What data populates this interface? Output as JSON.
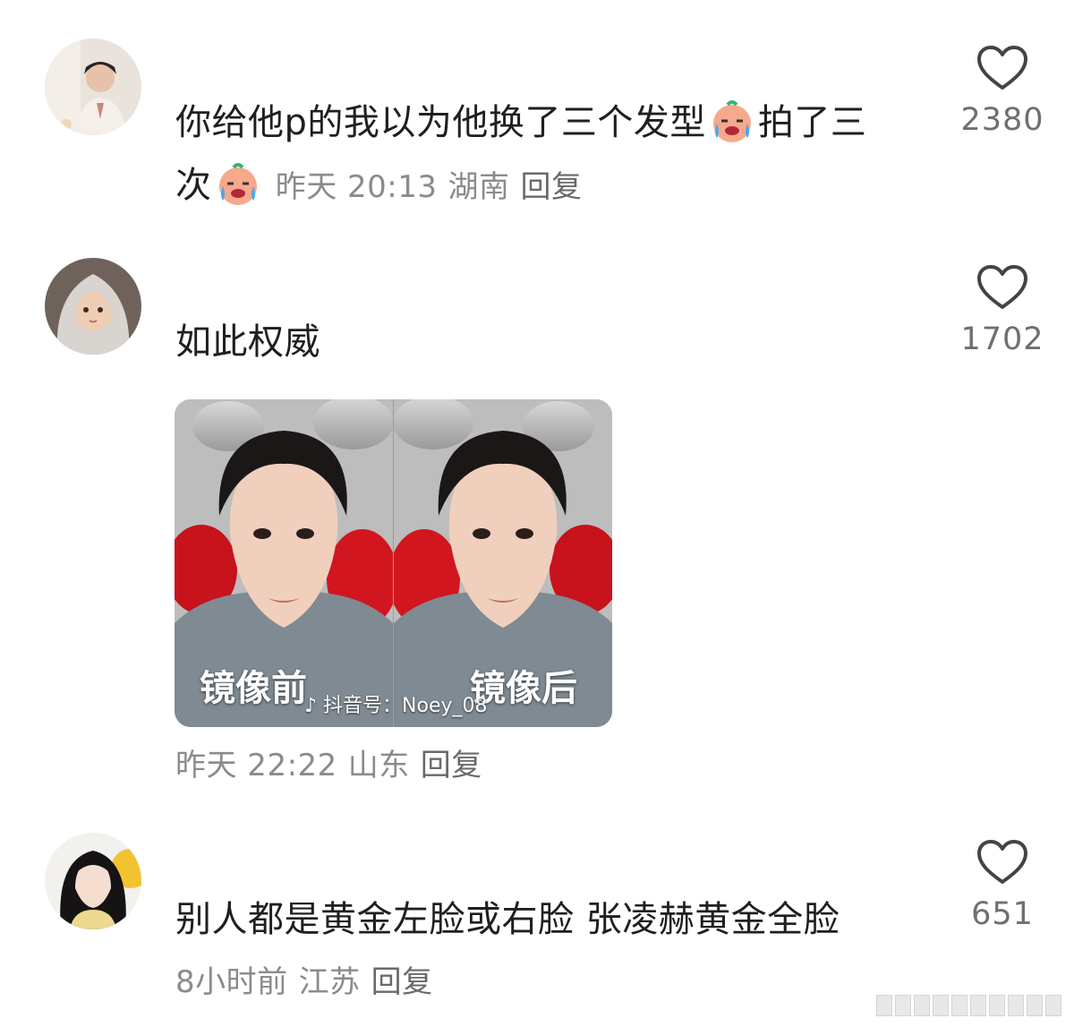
{
  "comments": [
    {
      "text_part1": "你给他p的我以为他换了三个发型",
      "text_part2": "拍了三",
      "text_part3": "次",
      "emoji_icon": "crying-face-emoji",
      "time": "昨天 20:13",
      "location": "湖南",
      "reply_label": "回复",
      "like_icon": "heart-outline-icon",
      "likes": "2380"
    },
    {
      "text": "如此权威",
      "media": {
        "caption_left": "镜像前",
        "caption_right": "镜像后",
        "watermark": "抖音号：Noey_08"
      },
      "time": "昨天 22:22",
      "location": "山东",
      "reply_label": "回复",
      "like_icon": "heart-outline-icon",
      "likes": "1702"
    },
    {
      "text": "别人都是黄金左脸或右脸 张凌赫黄金全脸",
      "time": "8小时前",
      "location": "江苏",
      "reply_label": "回复",
      "like_icon": "heart-outline-icon",
      "likes": "651"
    }
  ],
  "colors": {
    "text": "#1f1f1f",
    "meta": "#8b8b8b",
    "count": "#6f6f6f",
    "background": "#ffffff"
  }
}
